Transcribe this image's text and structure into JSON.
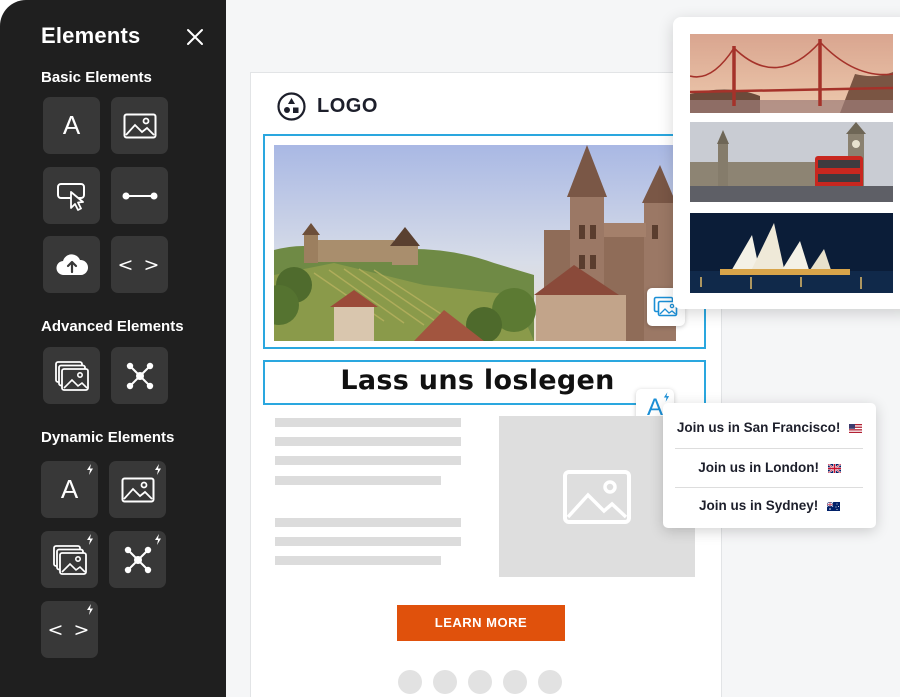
{
  "panel": {
    "title": "Elements",
    "sections": {
      "basic": "Basic Elements",
      "advanced": "Advanced Elements",
      "dynamic": "Dynamic Elements"
    },
    "tile_glyphs": {
      "text": "A",
      "html": "< >"
    }
  },
  "email": {
    "logo_text": "LOGO",
    "headline": "Lass uns loslegen",
    "cta_label": "LEARN MORE",
    "social_count": 5
  },
  "dynamic_text": {
    "badge_glyph": "A",
    "variants": [
      {
        "text": "Join us in San Francisco!",
        "flag": "us-flag-icon"
      },
      {
        "text": "Join us in London!",
        "flag": "uk-flag-icon"
      },
      {
        "text": "Join us in Sydney!",
        "flag": "au-flag-icon"
      }
    ]
  },
  "dynamic_images": [
    "golden-gate-bridge",
    "london-westminster",
    "sydney-opera-house"
  ],
  "colors": {
    "panel_bg": "#1f1f1f",
    "tile_bg": "#383838",
    "accent_blue": "#2aa7df",
    "cta_orange": "#e0510c",
    "placeholder_gray": "#dcdcdc"
  }
}
